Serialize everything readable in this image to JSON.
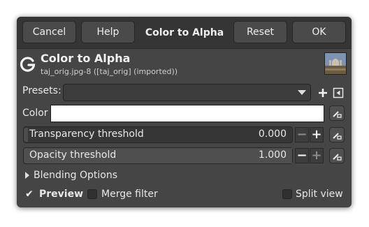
{
  "header": {
    "cancel_label": "Cancel",
    "help_label": "Help",
    "title": "Color to Alpha",
    "reset_label": "Reset",
    "ok_label": "OK"
  },
  "filter": {
    "title": "Color to Alpha",
    "subtitle": "taj_orig.jpg-8 ([taj_orig] (imported))",
    "logo_letter": "G"
  },
  "presets": {
    "label": "Presets:",
    "value": ""
  },
  "color": {
    "label": "Color",
    "value_hex": "#ffffff"
  },
  "transparency_threshold": {
    "label": "Transparency threshold",
    "value": "0.000",
    "fraction": 0.0
  },
  "opacity_threshold": {
    "label": "Opacity threshold",
    "value": "1.000",
    "fraction": 1.0
  },
  "blending": {
    "label": "Blending Options"
  },
  "options": {
    "preview_label": "Preview",
    "preview_checked": true,
    "merge_label": "Merge filter",
    "merge_checked": false,
    "split_label": "Split view",
    "split_checked": false
  },
  "colors": {
    "dialog_bg": "#454545",
    "header_bg": "#353535"
  }
}
